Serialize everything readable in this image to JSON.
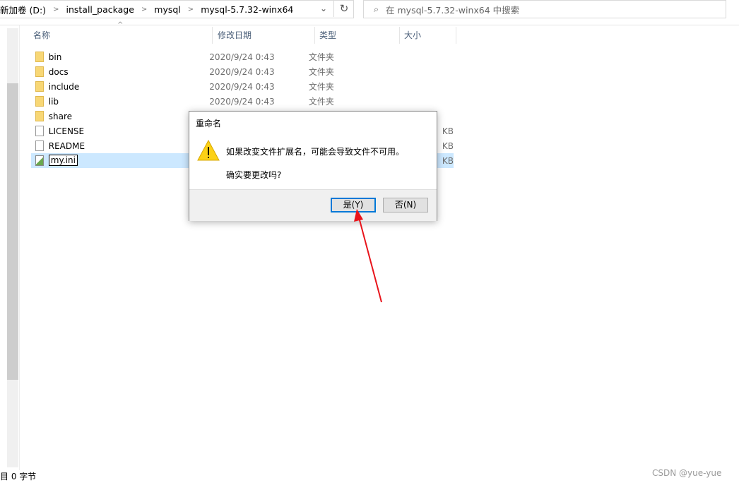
{
  "address_bar": {
    "crumbs": [
      "新加卷 (D:)",
      "install_package",
      "mysql",
      "mysql-5.7.32-winx64"
    ]
  },
  "search": {
    "placeholder": "在 mysql-5.7.32-winx64 中搜索"
  },
  "columns": {
    "name": "名称",
    "date": "修改日期",
    "type": "类型",
    "size": "大小"
  },
  "files": [
    {
      "name": "bin",
      "date": "2020/9/24 0:43",
      "type": "文件夹",
      "size": "",
      "icon": "folder"
    },
    {
      "name": "docs",
      "date": "2020/9/24 0:43",
      "type": "文件夹",
      "size": "",
      "icon": "folder"
    },
    {
      "name": "include",
      "date": "2020/9/24 0:43",
      "type": "文件夹",
      "size": "",
      "icon": "folder"
    },
    {
      "name": "lib",
      "date": "2020/9/24 0:43",
      "type": "文件夹",
      "size": "",
      "icon": "folder"
    },
    {
      "name": "share",
      "date": "",
      "type": "",
      "size": "",
      "icon": "folder"
    },
    {
      "name": "LICENSE",
      "date": "",
      "type": "",
      "size": "KB",
      "icon": "file"
    },
    {
      "name": "README",
      "date": "",
      "type": "",
      "size": "KB",
      "icon": "file"
    },
    {
      "name": "my.ini",
      "date": "",
      "type": "",
      "size": "KB",
      "icon": "ini"
    }
  ],
  "dialog": {
    "title": "重命名",
    "message": "如果改变文件扩展名，可能会导致文件不可用。",
    "question": "确实要更改吗?",
    "yes": "是(Y)",
    "no": "否(N)"
  },
  "status_bar": {
    "text": "0 字节"
  },
  "watermark": "CSDN @yue-yue",
  "colors": {
    "selection": "#cce8ff",
    "accent": "#0078d7",
    "arrow": "#e8141b"
  }
}
